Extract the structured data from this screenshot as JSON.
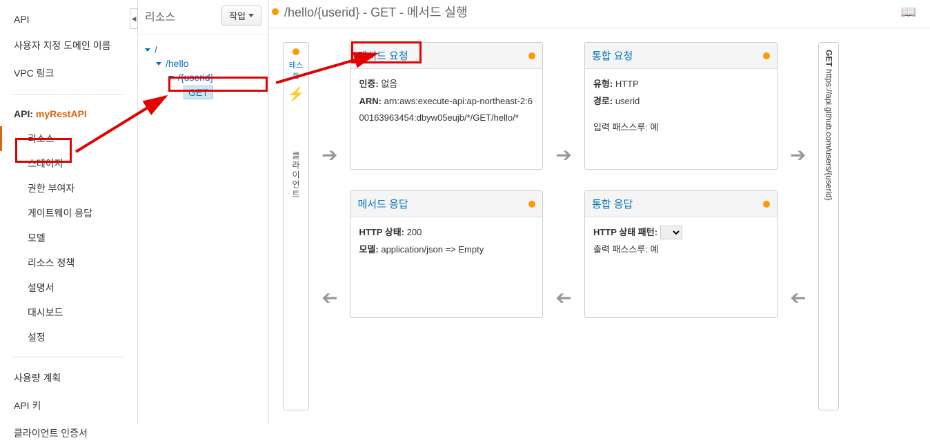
{
  "nav": {
    "items": [
      "API",
      "사용자 지정 도메인 이름",
      "VPC 링크"
    ],
    "api_label_prefix": "API: ",
    "api_name": "myRestAPI",
    "sub_items": [
      "리소스",
      "스테이지",
      "권한 부여자",
      "게이트웨이 응답",
      "모델",
      "리소스 정책",
      "설명서",
      "대시보드",
      "설정"
    ],
    "items2": [
      "사용량 계획",
      "API 키",
      "클라이언트 인증서"
    ]
  },
  "tree": {
    "title": "리소스",
    "action_label": "작업",
    "root": "/",
    "level1": "/hello",
    "level2": "/{userid}",
    "method": "GET"
  },
  "header": {
    "title": "/hello/{userid} - GET - 메서드 실행"
  },
  "client": {
    "label": "테스트",
    "vertical": "클라이언트"
  },
  "cards": {
    "method_request": {
      "title": "메서드 요청",
      "auth_label": "인증:",
      "auth_value": "없음",
      "arn_label": "ARN:",
      "arn_value": "arn:aws:execute-api:ap-northeast-2:600163963454:dbyw05eujb/*/GET/hello/*"
    },
    "integration_request": {
      "title": "통합 요청",
      "type_label": "유형:",
      "type_value": "HTTP",
      "path_label": "경로:",
      "path_value": "userid",
      "passthrough_label": "입력 패스스루:",
      "passthrough_value": "예"
    },
    "method_response": {
      "title": "메서드 응답",
      "status_label": "HTTP 상태:",
      "status_value": "200",
      "model_label": "모델:",
      "model_value": "application/json => Empty"
    },
    "integration_response": {
      "title": "통합 응답",
      "pattern_label": "HTTP 상태 패턴:",
      "pattern_value": "-",
      "passthrough_label": "출력 패스스루:",
      "passthrough_value": "예"
    }
  },
  "endpoint": {
    "method": "GET",
    "url": " https://api.github.com/users/{userid}"
  }
}
